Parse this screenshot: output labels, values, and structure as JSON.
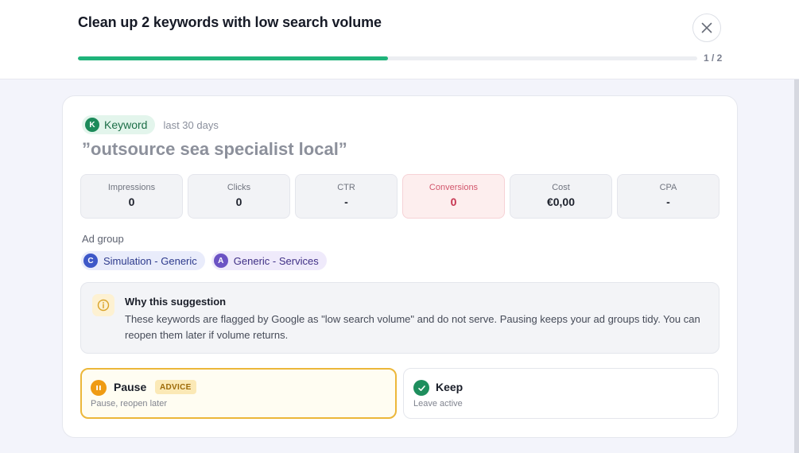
{
  "header": {
    "title": "Clean up 2 keywords with low search volume",
    "progress_fraction": 0.5,
    "step_counter": "1 / 2",
    "close_icon": "close-icon"
  },
  "keyword": {
    "badge_letter": "K",
    "badge_label": "Keyword",
    "period": "last 30 days",
    "text": "”outsource sea specialist local”"
  },
  "metrics": [
    {
      "label": "Impressions",
      "value": "0"
    },
    {
      "label": "Clicks",
      "value": "0"
    },
    {
      "label": "CTR",
      "value": "-"
    },
    {
      "label": "Conversions",
      "value": "0"
    },
    {
      "label": "Cost",
      "value": "€0,00"
    },
    {
      "label": "CPA",
      "value": "-"
    }
  ],
  "ad_group": {
    "label": "Ad group",
    "chips": [
      {
        "letter": "C",
        "name": "Simulation - Generic"
      },
      {
        "letter": "A",
        "name": "Generic - Services"
      }
    ]
  },
  "why": {
    "icon": "info-icon",
    "title": "Why this suggestion",
    "text": "These keywords are flagged by Google as \"low search volume\" and do not serve. Pausing keeps your ad groups tidy. You can reopen them later if volume returns."
  },
  "options": {
    "pause": {
      "icon": "pause-icon",
      "title": "Pause",
      "tag": "ADVICE",
      "subtitle": "Pause, reopen later"
    },
    "keep": {
      "icon": "check-icon",
      "title": "Keep",
      "subtitle": "Leave active"
    }
  },
  "colors": {
    "progress": "#1fb37a",
    "advice_border": "#ecb73a",
    "conversions_alert": "#c6334f"
  }
}
